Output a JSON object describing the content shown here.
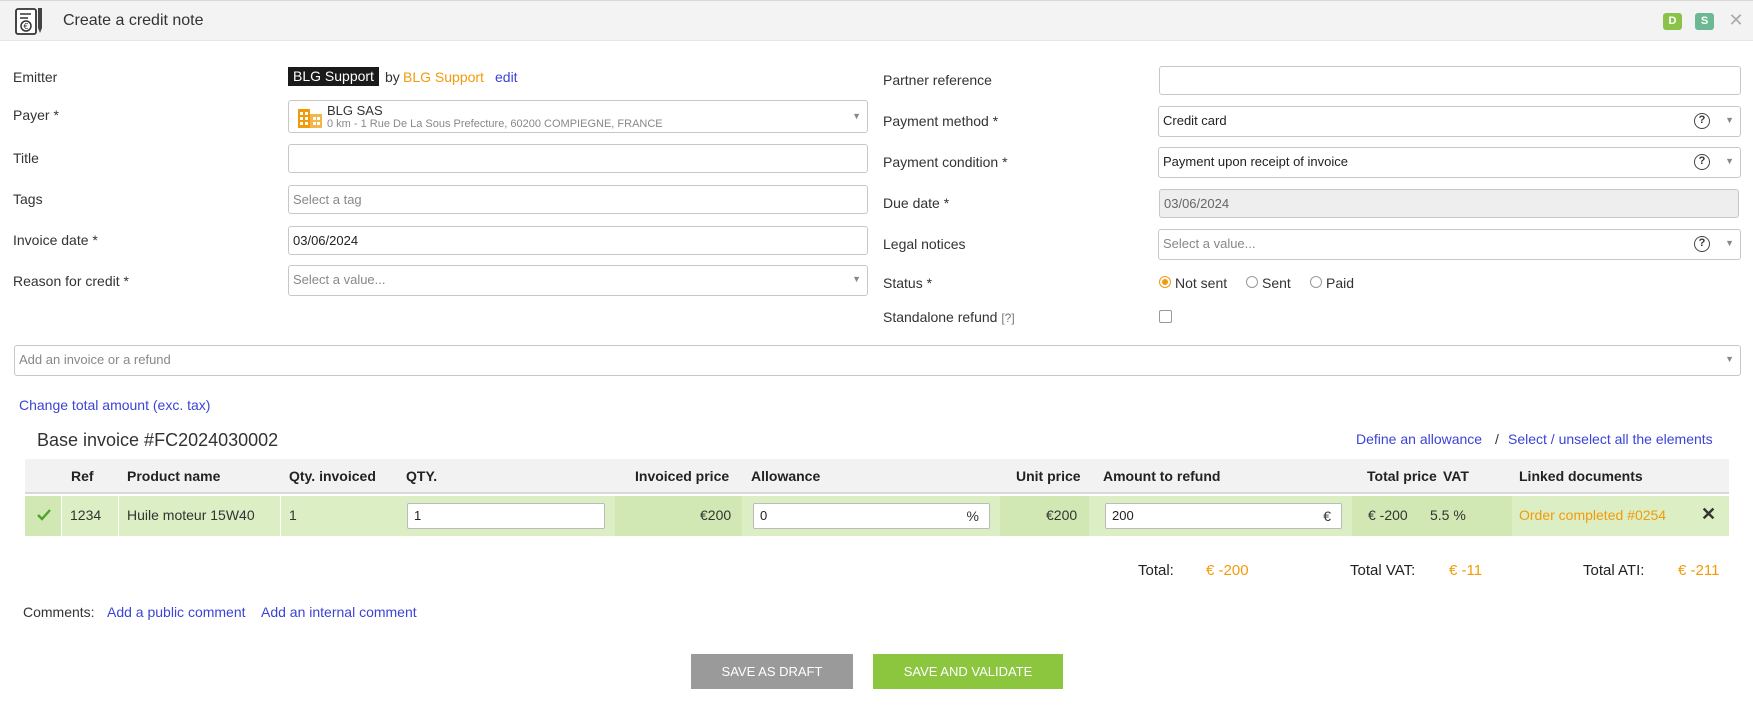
{
  "window": {
    "title": "Create a credit note",
    "badges": [
      "D",
      "S"
    ]
  },
  "form_left": {
    "emitter": {
      "label": "Emitter",
      "tag": "BLG Support",
      "by": "by",
      "name": "BLG Support",
      "edit": "edit"
    },
    "payer": {
      "label": "Payer *",
      "name": "BLG SAS",
      "address": "0 km - 1 Rue De La Sous Prefecture, 60200 COMPIEGNE, FRANCE"
    },
    "title": {
      "label": "Title",
      "value": ""
    },
    "tags": {
      "label": "Tags",
      "placeholder": "Select a tag"
    },
    "invoice_date": {
      "label": "Invoice date *",
      "value": "03/06/2024"
    },
    "reason": {
      "label": "Reason for credit *",
      "placeholder": "Select a value..."
    }
  },
  "form_right": {
    "partner_reference": {
      "label": "Partner reference",
      "value": ""
    },
    "payment_method": {
      "label": "Payment method *",
      "value": "Credit card"
    },
    "payment_condition": {
      "label": "Payment condition *",
      "value": "Payment upon receipt of invoice"
    },
    "due_date": {
      "label": "Due date *",
      "value": "03/06/2024"
    },
    "legal_notices": {
      "label": "Legal notices",
      "placeholder": "Select a value..."
    },
    "status": {
      "label": "Status *",
      "options": [
        "Not sent",
        "Sent",
        "Paid"
      ],
      "selected": "Not sent"
    },
    "standalone_refund": {
      "label": "Standalone refund",
      "help": "[?]",
      "checked": false
    }
  },
  "add_invoice": {
    "placeholder": "Add an invoice or a refund"
  },
  "change_total_link": "Change total amount (exc. tax)",
  "base_invoice": {
    "title": "Base invoice #FC2024030002",
    "define_allowance": "Define an allowance",
    "separator": "/",
    "select_all": "Select / unselect all the elements"
  },
  "table": {
    "headers": {
      "ref": "Ref",
      "product": "Product name",
      "qty_invoiced": "Qty. invoiced",
      "qty": "QTY.",
      "invoiced_price": "Invoiced price",
      "allowance": "Allowance",
      "unit_price": "Unit price",
      "amount_refund": "Amount to refund",
      "total_price": "Total price",
      "vat": "VAT",
      "linked_docs": "Linked documents"
    },
    "rows": [
      {
        "ref": "1234",
        "product": "Huile moteur 15W40",
        "qty_invoiced": "1",
        "qty": "1",
        "invoiced_price": "€200",
        "allowance": "0",
        "allowance_unit": "%",
        "unit_price": "€200",
        "amount_refund": "200",
        "amount_unit": "€",
        "total_price": "€ -200",
        "vat": "5.5 %",
        "linked_doc": "Order completed #0254"
      }
    ]
  },
  "totals": {
    "total_label": "Total:",
    "total_value": "€ -200",
    "vat_label": "Total VAT:",
    "vat_value": "€ -11",
    "ati_label": "Total ATI:",
    "ati_value": "€ -211"
  },
  "comments": {
    "label": "Comments:",
    "public": "Add a public comment",
    "internal": "Add an internal comment"
  },
  "buttons": {
    "draft": "SAVE AS DRAFT",
    "validate": "SAVE AND VALIDATE"
  },
  "colors": {
    "accent": "#f39a0b",
    "link": "#3b44d6",
    "row_bg": "#dcefc4",
    "validate": "#8cc63f",
    "draft": "#9a9a9a"
  }
}
